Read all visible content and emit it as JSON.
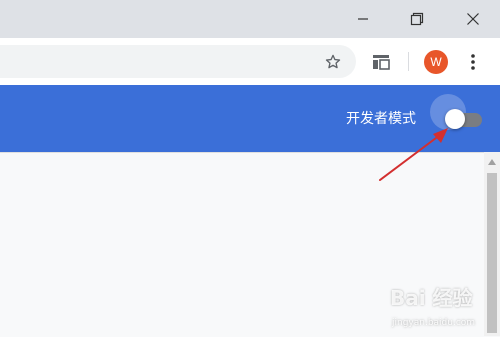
{
  "window": {
    "controls": [
      "minimize-icon",
      "restore-icon",
      "close-icon"
    ]
  },
  "toolbar": {
    "bookmark_icon": "star-icon",
    "extension_icon": "reading-list-icon",
    "avatar_letter": "W",
    "avatar_color": "#e8562a",
    "menu_icon": "more-vert-icon"
  },
  "header": {
    "background_color": "#3b6fd8",
    "developer_mode_label": "开发者模式",
    "developer_mode_enabled": false
  },
  "annotation": {
    "arrow_color": "#d32f2f"
  },
  "watermark": {
    "main": "Bai 经验",
    "sub": "jingyan.baidu.com"
  }
}
